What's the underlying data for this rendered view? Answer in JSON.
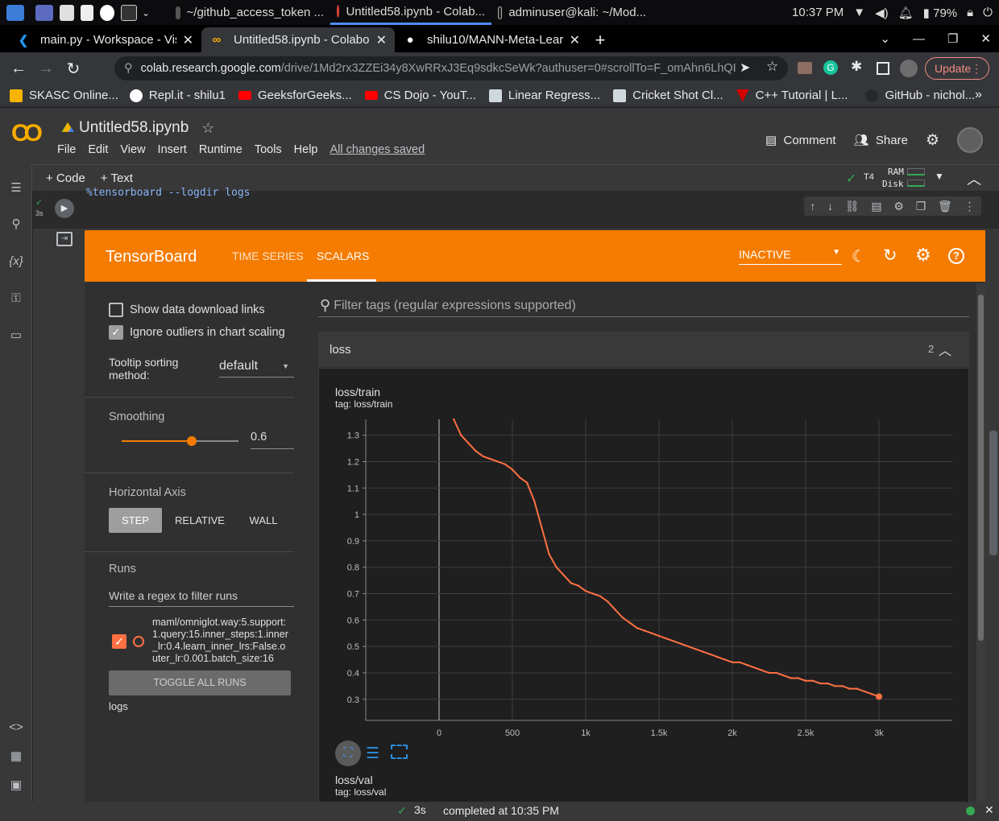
{
  "taskbar": {
    "tasks": [
      {
        "label": "~/github_access_token ..."
      },
      {
        "label": "Untitled58.ipynb - Colab..."
      },
      {
        "label": "adminuser@kali: ~/Mod..."
      }
    ],
    "clock": "10:37 PM",
    "battery": "79%"
  },
  "browser": {
    "tabs": [
      {
        "label": "main.py - Workspace - Vis",
        "icon": "vscode-icon"
      },
      {
        "label": "Untitled58.ipynb - Colabo",
        "icon": "colab-icon"
      },
      {
        "label": "shilu10/MANN-Meta-Lear",
        "icon": "github-icon"
      }
    ],
    "url_host": "colab.research.google.com",
    "url_path": "/drive/1Md2rx3ZZEi34y8XwRRxJ3Eq9sdkcSeWk?authuser=0#scrollTo=F_omAhn6LhQI",
    "update_label": "Update",
    "bookmarks": [
      {
        "label": "SKASC Online...",
        "color": "#f4b400"
      },
      {
        "label": "Repl.it - shilu1",
        "color": "#ffffff"
      },
      {
        "label": "GeeksforGeeks...",
        "color": "#ff0000"
      },
      {
        "label": "CS Dojo - YouT...",
        "color": "#ff0000"
      },
      {
        "label": "Linear Regress...",
        "color": "#cfd8dc"
      },
      {
        "label": "Cricket Shot Cl...",
        "color": "#cfd8dc"
      },
      {
        "label": "C++ Tutorial | L...",
        "color": "#d50000"
      },
      {
        "label": "GitHub - nichol...",
        "color": "#24292e"
      }
    ],
    "bookmarks_more": "»"
  },
  "colab": {
    "notebook_title": "Untitled58.ipynb",
    "menu": [
      "File",
      "Edit",
      "View",
      "Insert",
      "Runtime",
      "Tools",
      "Help"
    ],
    "saved_status": "All changes saved",
    "comment_label": "Comment",
    "share_label": "Share",
    "add_code": "+ Code",
    "add_text": "+ Text",
    "runtime_gpu": "T4",
    "ram_label": "RAM",
    "disk_label": "Disk",
    "cell_code": "%tensorboard --logdir logs",
    "exec_time": "3s"
  },
  "tensorboard": {
    "title": "TensorBoard",
    "nav": [
      "TIME SERIES",
      "SCALARS"
    ],
    "active_nav": "SCALARS",
    "status_select": "INACTIVE",
    "show_download_links": "Show data download links",
    "ignore_outliers": "Ignore outliers in chart scaling",
    "tooltip_sorting_label": "Tooltip sorting method:",
    "tooltip_sorting_value": "default",
    "smoothing_label": "Smoothing",
    "smoothing_value": "0.6",
    "smoothing_fraction": 0.6,
    "horizontal_axis_label": "Horizontal Axis",
    "axis_options": [
      "STEP",
      "RELATIVE",
      "WALL"
    ],
    "axis_selected": "STEP",
    "runs_label": "Runs",
    "runs_filter_placeholder": "Write a regex to filter runs",
    "run_name": "maml/omniglot.way:5.support:1.query:15.inner_steps:1.inner_lr:0.4.learn_inner_lrs:False.outer_lr:0.001.batch_size:16",
    "toggle_all": "TOGGLE ALL RUNS",
    "logdir": "logs",
    "filter_placeholder": "Filter tags (regular expressions supported)",
    "group_name": "loss",
    "group_count": "2",
    "accent": "#f57c00",
    "run_color": "#ff7043"
  },
  "chart_data": {
    "type": "line",
    "title": "loss/train",
    "subtitle": "tag: loss/train",
    "xlabel": "",
    "ylabel": "",
    "xlim": [
      -500,
      3500
    ],
    "ylim": [
      0.22,
      1.36
    ],
    "xticks": [
      0,
      500,
      1000,
      1500,
      2000,
      2500,
      3000
    ],
    "xtick_labels": [
      "0",
      "500",
      "1k",
      "1.5k",
      "2k",
      "2.5k",
      "3k"
    ],
    "yticks": [
      0.3,
      0.4,
      0.5,
      0.6,
      0.7,
      0.8,
      0.9,
      1,
      1.1,
      1.2,
      1.3
    ],
    "ytick_labels": [
      "0.3",
      "0.4",
      "0.5",
      "0.6",
      "0.7",
      "0.8",
      "0.9",
      "1",
      "1.1",
      "1.2",
      "1.3"
    ],
    "grid": true,
    "series": [
      {
        "x": [
          100,
          150,
          200,
          250,
          300,
          350,
          400,
          450,
          500,
          550,
          600,
          650,
          700,
          750,
          800,
          850,
          900,
          950,
          1000,
          1050,
          1100,
          1150,
          1200,
          1250,
          1300,
          1350,
          1400,
          1450,
          1500,
          1550,
          1600,
          1650,
          1700,
          1750,
          1800,
          1850,
          1900,
          1950,
          2000,
          2050,
          2100,
          2150,
          2200,
          2250,
          2300,
          2350,
          2400,
          2450,
          2500,
          2550,
          2600,
          2650,
          2700,
          2750,
          2800,
          2850,
          2900,
          2950,
          3000
        ],
        "values": [
          1.36,
          1.3,
          1.27,
          1.24,
          1.22,
          1.21,
          1.2,
          1.19,
          1.17,
          1.14,
          1.12,
          1.05,
          0.95,
          0.85,
          0.8,
          0.77,
          0.74,
          0.73,
          0.71,
          0.7,
          0.69,
          0.67,
          0.64,
          0.61,
          0.59,
          0.57,
          0.56,
          0.55,
          0.54,
          0.53,
          0.52,
          0.51,
          0.5,
          0.49,
          0.48,
          0.47,
          0.46,
          0.45,
          0.44,
          0.44,
          0.43,
          0.42,
          0.41,
          0.4,
          0.4,
          0.39,
          0.38,
          0.38,
          0.37,
          0.37,
          0.36,
          0.36,
          0.35,
          0.35,
          0.34,
          0.34,
          0.33,
          0.32,
          0.31
        ]
      }
    ]
  },
  "second_chart": {
    "title": "loss/val",
    "subtitle": "tag: loss/val"
  },
  "statusbar": {
    "exec_time": "3s",
    "completed": "completed at 10:35 PM"
  }
}
